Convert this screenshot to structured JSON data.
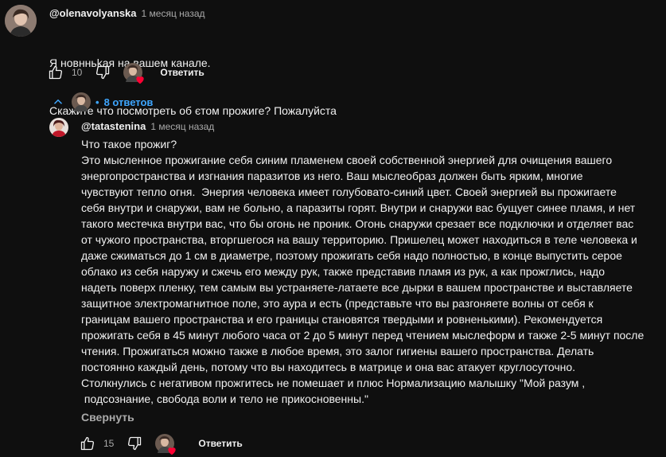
{
  "comment": {
    "author": "@olenavolyanska",
    "time": "1 месяц назад",
    "text_line1": "Я новнньkая на вашем канале.",
    "text_line2": "Скажите что посмотреть об єтом прожиге? Пожалуйста",
    "likes": "10",
    "reply_label": "Ответить"
  },
  "replies_toggle": {
    "label": "8 ответов",
    "separator": "•"
  },
  "reply": {
    "author": "@tatastenina",
    "time": "1 месяц назад",
    "lines": [
      "Что такое прожиг?",
      "Это мысленное прожигание себя синим пламенем своей собственной энергией для очищения вашего",
      "энергопространства и изгнания паразитов из него. Ваш мыслеобраз должен быть ярким, многие",
      "чувствуют тепло огня.  Энергия человека имеет голубовато-синий цвет. Своей энергией вы прожигаете",
      "себя внутри и снаружи, вам не больно, а паразиты горят. Внутри и снаружи вас бущует синее пламя, и нет",
      "такого местечка внутри вас, что бы огонь не проник. Огонь снаружи срезает все подключки и отделяет вас",
      "от чужого пространства, вторгшегося на вашу территорию. Пришелец может находиться в теле человека и",
      "даже сжиматься до 1 см в диаметре, поэтому прожигать себя надо полностью, в конце выпустить серое",
      "облако из себя наружу и сжечь его между рук, также представив пламя из рук, а как прожглись, надо",
      "надеть поверх пленку, тем самым вы устраняете-латаете все дырки в вашем пространстве и выставляете",
      "защитное электромагнитное поле, это аура и есть (представьте что вы разгоняете волны от себя к",
      "границам вашего пространства и его границы становятся твердыми и ровненькими). Рекомендуется",
      "прожигать себя в 45 минут любого часа от 2 до 5 минут перед чтением мыслеформ и также 2-5 минут после",
      "чтения. Прожигаться можно также в любое время, это залог гигиены вашего пространства. Делать",
      "постоянно каждый день, потому что вы находитесь в матрице и она вас атакует круглосуточно.",
      "Столкнулись с негативом прожгитесь не помешает и плюс Нормализацию малышку \"Мой разум ,",
      " подсознание, свобода воли и тело не прикосновенны.\""
    ],
    "collapse_label": "Свернуть",
    "likes": "15",
    "reply_label": "Ответить"
  },
  "icons": {
    "like": "thumb-up-icon",
    "dislike": "thumb-down-icon",
    "heart": "heart-icon",
    "chevron": "chevron-up-icon"
  },
  "colors": {
    "background": "#0f0f0f",
    "text": "#f1f1f1",
    "secondary": "#aaaaaa",
    "link": "#3ea6ff",
    "heart": "#ff0033"
  }
}
